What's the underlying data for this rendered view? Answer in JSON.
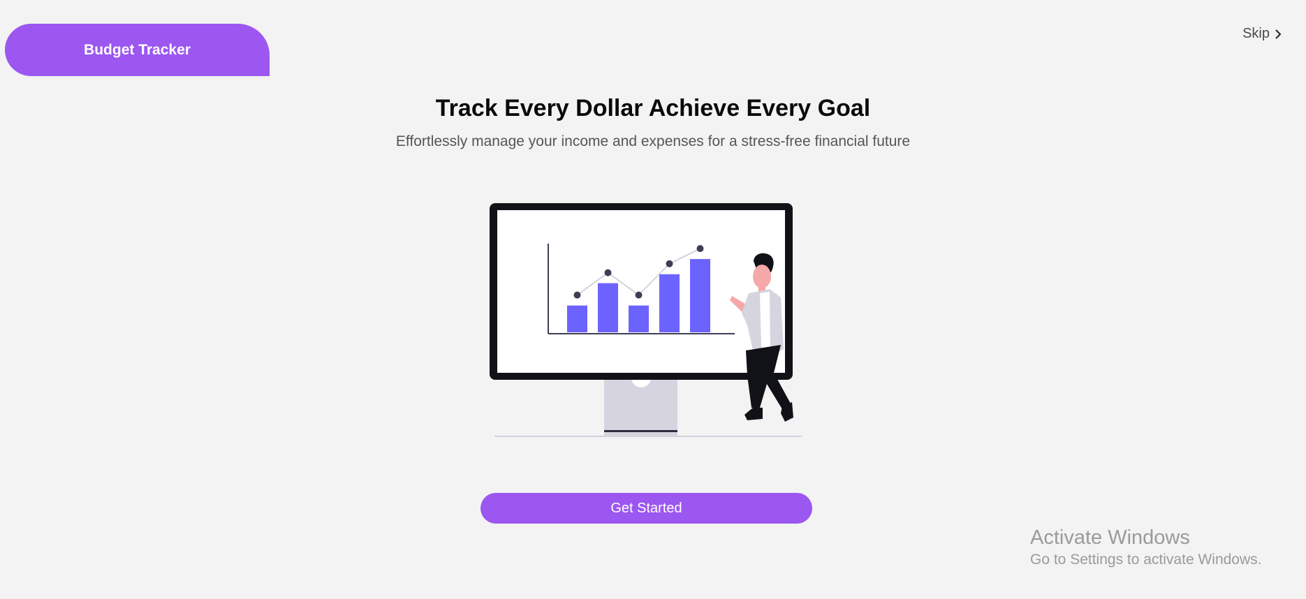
{
  "brand": {
    "label": "Budget Tracker"
  },
  "header": {
    "skip_label": "Skip"
  },
  "hero": {
    "title": "Track Every Dollar Achieve Every Goal",
    "subtitle": "Effortlessly manage your income and expenses for a stress-free financial future"
  },
  "illustration": {
    "icon": "presentation-chart-illustration",
    "bar_levels": [
      0.3,
      0.55,
      0.3,
      0.65,
      0.82
    ],
    "accent_color": "#6c63ff"
  },
  "cta": {
    "label": "Get Started"
  },
  "watermark": {
    "title": "Activate Windows",
    "subtitle": "Go to Settings to activate Windows."
  },
  "colors": {
    "primary": "#9b57f0",
    "background": "#f3f3f3",
    "headline": "#0a0a0a",
    "subtitle": "#555555"
  }
}
